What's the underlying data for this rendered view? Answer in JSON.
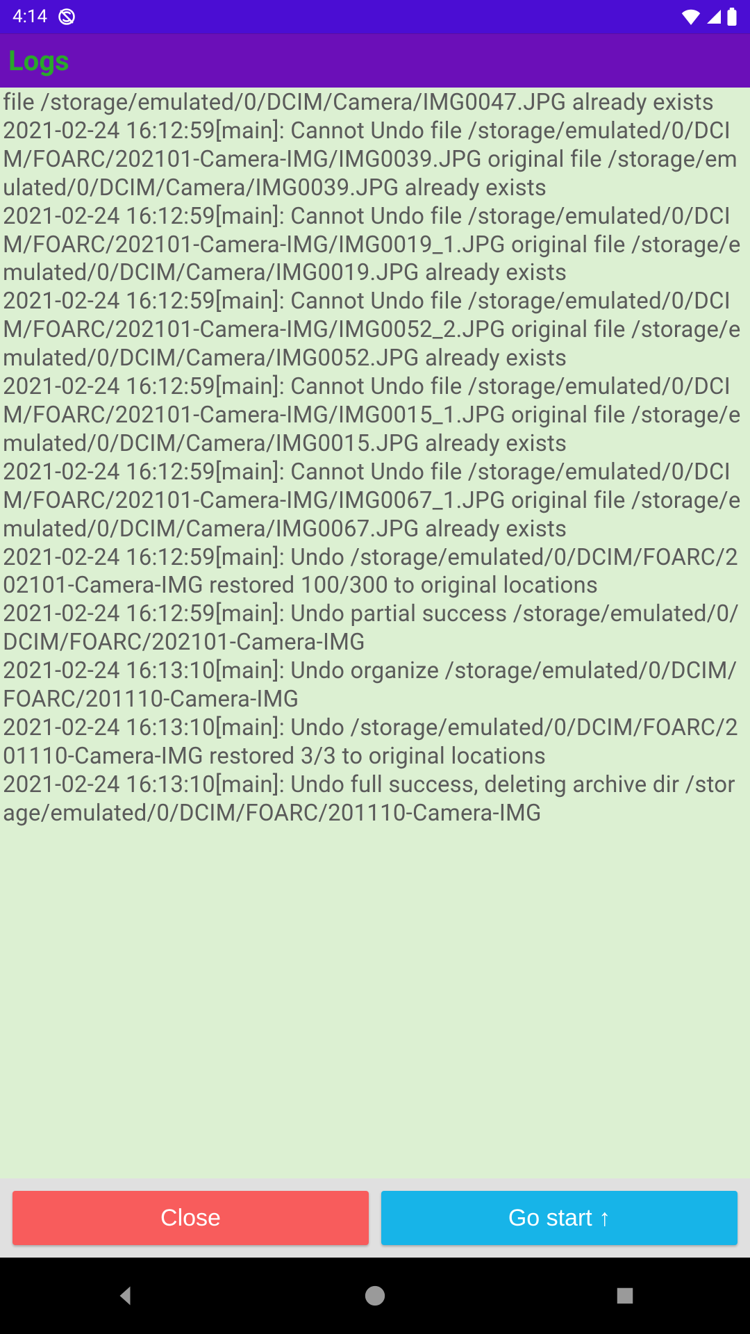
{
  "status": {
    "time": "4:14"
  },
  "appbar": {
    "title": "Logs"
  },
  "logs": {
    "fragment_first": "file /storage/emulated/0/DCIM/Camera/IMG0047.JPG already exists",
    "entries": [
      "2021-02-24 16:12:59[main]: Cannot Undo file /storage/emulated/0/DCIM/FOARC/202101-Camera-IMG/IMG0039.JPG original file /storage/emulated/0/DCIM/Camera/IMG0039.JPG already exists",
      "2021-02-24 16:12:59[main]: Cannot Undo file /storage/emulated/0/DCIM/FOARC/202101-Camera-IMG/IMG0019_1.JPG original file /storage/emulated/0/DCIM/Camera/IMG0019.JPG already exists",
      "2021-02-24 16:12:59[main]: Cannot Undo file /storage/emulated/0/DCIM/FOARC/202101-Camera-IMG/IMG0052_2.JPG original file /storage/emulated/0/DCIM/Camera/IMG0052.JPG already exists",
      "2021-02-24 16:12:59[main]: Cannot Undo file /storage/emulated/0/DCIM/FOARC/202101-Camera-IMG/IMG0015_1.JPG original file /storage/emulated/0/DCIM/Camera/IMG0015.JPG already exists",
      "2021-02-24 16:12:59[main]: Cannot Undo file /storage/emulated/0/DCIM/FOARC/202101-Camera-IMG/IMG0067_1.JPG original file /storage/emulated/0/DCIM/Camera/IMG0067.JPG already exists",
      "2021-02-24 16:12:59[main]: Undo /storage/emulated/0/DCIM/FOARC/202101-Camera-IMG restored 100/300 to original locations",
      "2021-02-24 16:12:59[main]: Undo partial success /storage/emulated/0/DCIM/FOARC/202101-Camera-IMG",
      "2021-02-24 16:13:10[main]: Undo organize /storage/emulated/0/DCIM/FOARC/201110-Camera-IMG",
      "2021-02-24 16:13:10[main]: Undo /storage/emulated/0/DCIM/FOARC/201110-Camera-IMG restored 3/3 to original locations",
      "2021-02-24 16:13:10[main]: Undo full success, deleting archive dir /storage/emulated/0/DCIM/FOARC/201110-Camera-IMG"
    ]
  },
  "buttons": {
    "close": "Close",
    "gostart": "Go start ↑"
  }
}
